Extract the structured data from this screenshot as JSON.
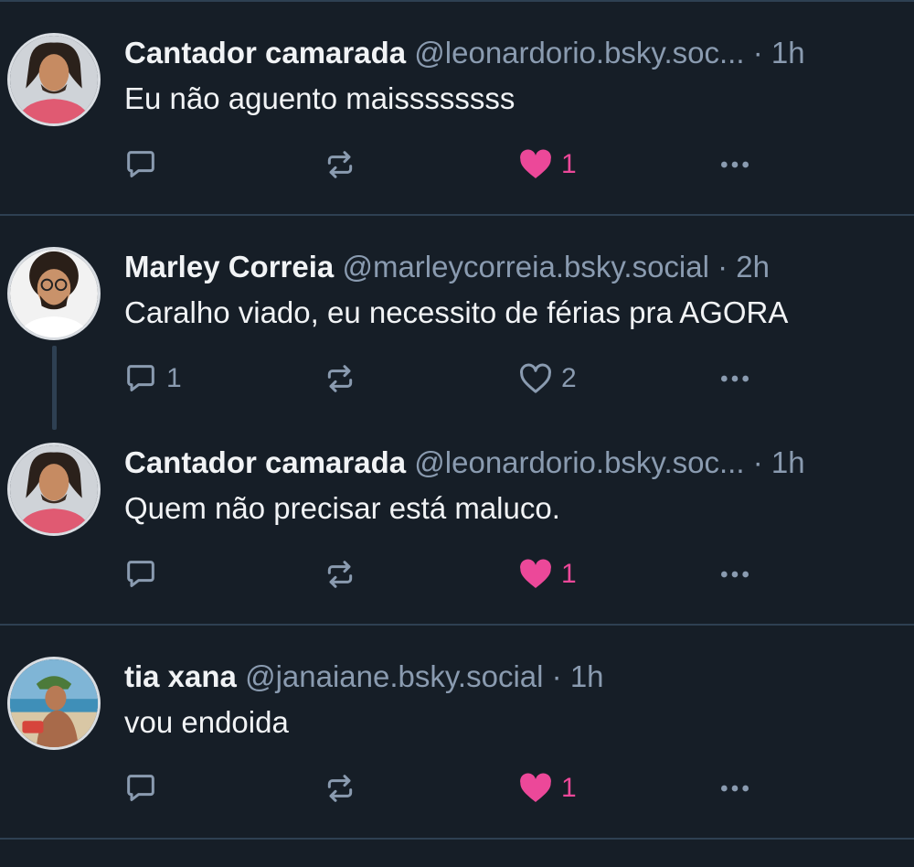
{
  "posts": [
    {
      "author": "Cantador camarada",
      "handle": "@leonardorio.bsky.soc...",
      "separator": "·",
      "time": "1h",
      "text": "Eu não aguento maissssssss",
      "reply_count": "",
      "repost_count": "",
      "like_count": "1",
      "liked": true
    },
    {
      "author": "Marley Correia",
      "handle": "@marleycorreia.bsky.social",
      "separator": "·",
      "time": "2h",
      "text": "Caralho viado, eu necessito de férias pra AGORA",
      "reply_count": "1",
      "repost_count": "",
      "like_count": "2",
      "liked": false
    },
    {
      "author": "Cantador camarada",
      "handle": "@leonardorio.bsky.soc...",
      "separator": "·",
      "time": "1h",
      "text": "Quem não precisar está maluco.",
      "reply_count": "",
      "repost_count": "",
      "like_count": "1",
      "liked": true
    },
    {
      "author": "tia xana",
      "handle": "@janaiane.bsky.social",
      "separator": "·",
      "time": "1h",
      "text": "vou endoida",
      "reply_count": "",
      "repost_count": "",
      "like_count": "1",
      "liked": true
    }
  ],
  "colors": {
    "background": "#161e27",
    "divider": "#2e4052",
    "muted": "#8a9bb0",
    "like": "#ec4899",
    "text": "#f1f3f5"
  },
  "icons": {
    "reply": "reply-bubble-icon",
    "repost": "repost-arrows-icon",
    "like": "heart-icon",
    "more": "more-dots-icon"
  }
}
